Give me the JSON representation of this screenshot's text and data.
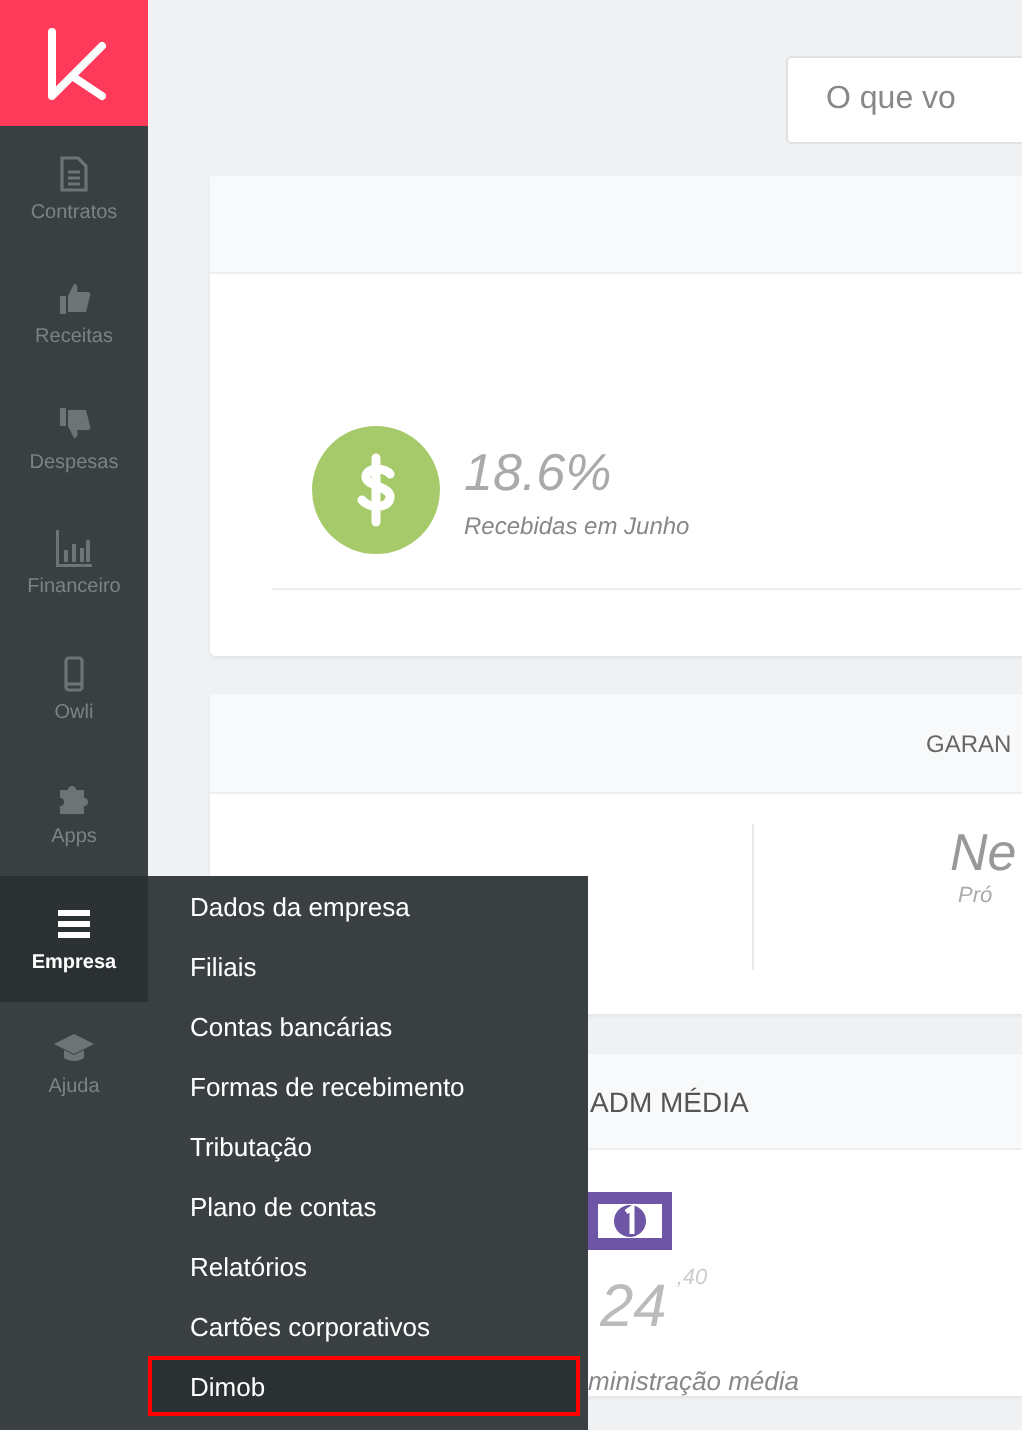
{
  "sidebar": {
    "items": [
      {
        "label": "Contratos",
        "selected": false
      },
      {
        "label": "Receitas",
        "selected": false
      },
      {
        "label": "Despesas",
        "selected": false
      },
      {
        "label": "Financeiro",
        "selected": false
      },
      {
        "label": "Owli",
        "selected": false
      },
      {
        "label": "Apps",
        "selected": false
      },
      {
        "label": "Empresa",
        "selected": true
      },
      {
        "label": "Ajuda",
        "selected": false
      }
    ]
  },
  "search": {
    "placeholder": "O que vo"
  },
  "summary_card": {
    "value": "18.6%",
    "caption": "Recebidas em Junho"
  },
  "guarantee_card": {
    "title": "GARAN",
    "right_value": "Ne",
    "right_caption": "Pró"
  },
  "adm_card": {
    "title": "ADM MÉDIA",
    "value": "24",
    "cents": ",40",
    "caption": "ministração média"
  },
  "submenu": {
    "items": [
      {
        "label": "Dados da empresa",
        "selected": false
      },
      {
        "label": "Filiais",
        "selected": false
      },
      {
        "label": "Contas bancárias",
        "selected": false
      },
      {
        "label": "Formas de recebimento",
        "selected": false
      },
      {
        "label": "Tributação",
        "selected": false
      },
      {
        "label": "Plano de contas",
        "selected": false
      },
      {
        "label": "Relatórios",
        "selected": false
      },
      {
        "label": "Cartões corporativos",
        "selected": false
      },
      {
        "label": "Dimob",
        "selected": true
      }
    ]
  }
}
